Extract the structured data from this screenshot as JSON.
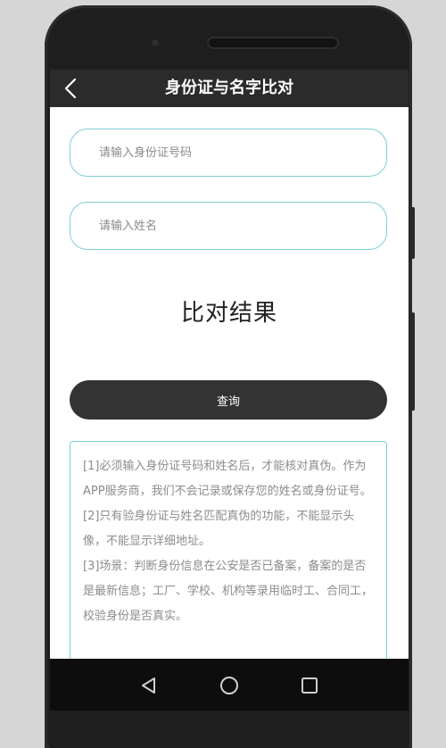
{
  "titlebar": {
    "title": "身份证与名字比对",
    "back_icon": "chevron-left-icon"
  },
  "form": {
    "id_placeholder": "请输入身份证号码",
    "id_value": "",
    "name_placeholder": "请输入姓名",
    "name_value": ""
  },
  "result": {
    "title": "比对结果"
  },
  "query_button": {
    "label": "查询"
  },
  "notes": [
    "[1]必须输入身份证号码和姓名后，才能核对真伪。作为APP服务商，我们不会记录或保存您的姓名或身份证号。",
    "[2]只有验身份证与姓名匹配真伪的功能，不能显示头像，不能显示详细地址。",
    "[3]场景：判断身份信息在公安是否已备案，备案的是否是最新信息；工厂、学校、机构等录用临时工、合同工，校验身份是否真实。"
  ],
  "navbar": {
    "back_icon": "triangle-back-icon",
    "home_icon": "circle-home-icon",
    "recents_icon": "square-recents-icon"
  },
  "colors": {
    "titlebar_bg": "#2b2b2b",
    "field_border": "#7fcfd8",
    "button_bg": "#333333",
    "note_text": "#8c8c8c"
  }
}
